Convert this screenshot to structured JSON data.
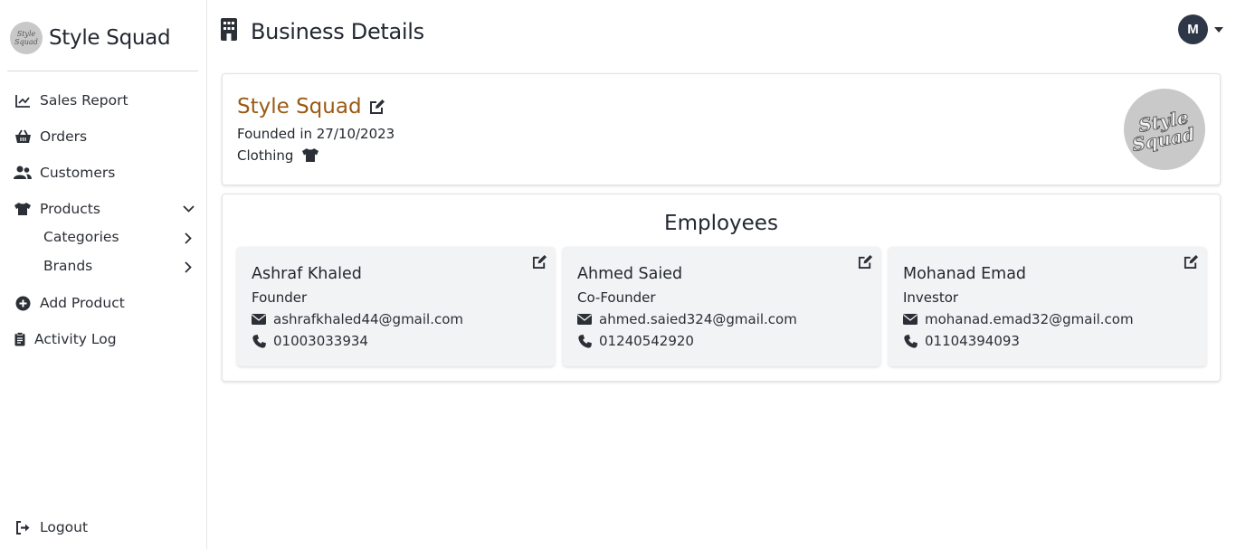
{
  "app": {
    "name": "Style Squad",
    "logo_text": "Style Squad"
  },
  "sidebar": {
    "items": [
      {
        "label": "Sales Report",
        "icon": "chart-line-icon"
      },
      {
        "label": "Orders",
        "icon": "basket-icon"
      },
      {
        "label": "Customers",
        "icon": "users-icon"
      },
      {
        "label": "Products",
        "icon": "shirt-icon",
        "expanded": true,
        "children": [
          {
            "label": "Categories"
          },
          {
            "label": "Brands"
          }
        ]
      },
      {
        "label": "Add Product",
        "icon": "plus-circle-icon"
      },
      {
        "label": "Activity Log",
        "icon": "clipboard-icon"
      }
    ],
    "logout_label": "Logout"
  },
  "header": {
    "title": "Business Details",
    "title_icon": "building-icon",
    "user_initial": "M"
  },
  "business": {
    "name": "Style Squad",
    "founded": "Founded in 27/10/2023",
    "category": "Clothing",
    "category_icon": "shirt-icon",
    "name_color": "#9a5a14"
  },
  "employees": {
    "heading": "Employees",
    "list": [
      {
        "name": "Ashraf Khaled",
        "role": "Founder",
        "email": "ashrafkhaled44@gmail.com",
        "phone": "01003033934"
      },
      {
        "name": "Ahmed Saied",
        "role": "Co-Founder",
        "email": "ahmed.saied324@gmail.com",
        "phone": "01240542920"
      },
      {
        "name": "Mohanad Emad",
        "role": "Investor",
        "email": "mohanad.emad32@gmail.com",
        "phone": "01104394093"
      }
    ]
  },
  "colors": {
    "accent_dark": "#2e3748",
    "text": "#232830",
    "card_bg": "#f2f3f5"
  }
}
